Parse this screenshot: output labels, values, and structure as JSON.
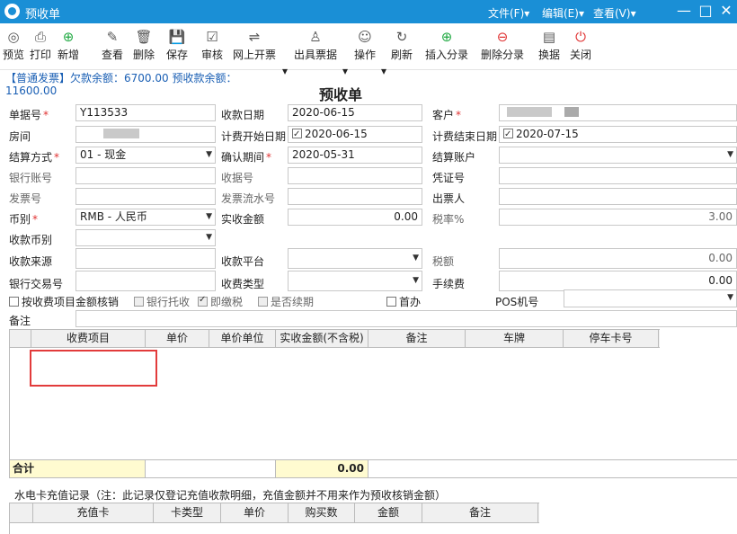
{
  "window": {
    "title": "预收单",
    "menus": [
      "文件(F)▾",
      "编辑(E)▾",
      "查看(V)▾"
    ],
    "controls": {
      "minimize": "—",
      "maximize": "□",
      "close": "✕"
    }
  },
  "toolbar": [
    {
      "id": "preview",
      "label": "预览",
      "icon": "◎"
    },
    {
      "id": "print",
      "label": "打印",
      "icon": "⎙"
    },
    {
      "id": "new",
      "label": "新增",
      "icon": "⊕"
    },
    {
      "id": "view",
      "label": "查看",
      "icon": "✎"
    },
    {
      "id": "delete",
      "label": "删除",
      "icon": "🗑"
    },
    {
      "id": "save",
      "label": "保存",
      "icon": "💾"
    },
    {
      "id": "audit",
      "label": "审核",
      "icon": "☑"
    },
    {
      "id": "online-invoice",
      "label": "网上开票",
      "icon": "⇌"
    },
    {
      "id": "issue-receipt",
      "label": "出具票据",
      "icon": "♙"
    },
    {
      "id": "operate",
      "label": "操作",
      "icon": "☺"
    },
    {
      "id": "refresh",
      "label": "刷新",
      "icon": "↻"
    },
    {
      "id": "insert-split",
      "label": "插入分录",
      "icon": "⊕"
    },
    {
      "id": "delete-split",
      "label": "删除分录",
      "icon": "⊖"
    },
    {
      "id": "change-doc",
      "label": "换据",
      "icon": "▤"
    },
    {
      "id": "close",
      "label": "关闭",
      "icon": "⏻"
    }
  ],
  "summary": {
    "invoice_type": "【普通发票】",
    "debt_label": "欠款余额：",
    "debt_value": "6700.00",
    "prepay_label": "预收款余额：",
    "prepay_value": "11600.00"
  },
  "form": {
    "title": "预收单",
    "doc_no_label": "单据号",
    "doc_no": "Y113533",
    "receive_date_label": "收款日期",
    "receive_date": "2020-06-15",
    "customer_label": "客户",
    "room_label": "房间",
    "billing_start_label": "计费开始日期",
    "billing_start": "2020-06-15",
    "billing_end_label": "计费结束日期",
    "billing_end": "2020-07-15",
    "settle_method_label": "结算方式",
    "settle_method": "01 - 现金",
    "confirm_period_label": "确认期间",
    "confirm_period": "2020-05-31",
    "settle_account_label": "结算账户",
    "bank_account_label": "银行账号",
    "receipt_no_label": "收据号",
    "voucher_no_label": "凭证号",
    "invoice_no_label": "发票号",
    "invoice_serial_label": "发票流水号",
    "drawer_label": "出票人",
    "currency_label": "币别",
    "currency": "RMB - 人民币",
    "actual_amount_label": "实收金额",
    "actual_amount": "0.00",
    "tax_rate_label": "税率%",
    "tax_rate": "3.00",
    "receive_currency_label": "收款币别",
    "source_label": "收款来源",
    "platform_label": "收款平台",
    "tax_amount_label": "税额",
    "tax_amount": "0.00",
    "bank_txn_label": "银行交易号",
    "receive_type_label": "收费类型",
    "fee_label": "手续费",
    "fee": "0.00",
    "opt_by_item": "按收费项目金额核销",
    "opt_bank": "银行托收",
    "opt_tax": "即缴税",
    "opt_renew": "是否续期",
    "opt_first": "首办",
    "pos_label": "POS机号",
    "remark_label": "备注"
  },
  "detail_grid": {
    "columns": [
      "收费项目",
      "单价",
      "单价单位",
      "实收金额(不含税)",
      "备注",
      "车牌",
      "停车卡号"
    ],
    "total_label": "合计",
    "total_amount": "0.00"
  },
  "recharge": {
    "title": "水电卡充值记录（注：此记录仅登记充值收款明细，充值金额并不用来作为预收核销金额）",
    "columns": [
      "充值卡",
      "卡类型",
      "单价",
      "购买数",
      "金额",
      "备注"
    ]
  },
  "colors": {
    "titlebar": "#1a8fd6",
    "summary_text": "#1a5fb4",
    "required": "#e03333",
    "total_highlight": "#fffbd0",
    "selection_box": "#e23b3b"
  }
}
